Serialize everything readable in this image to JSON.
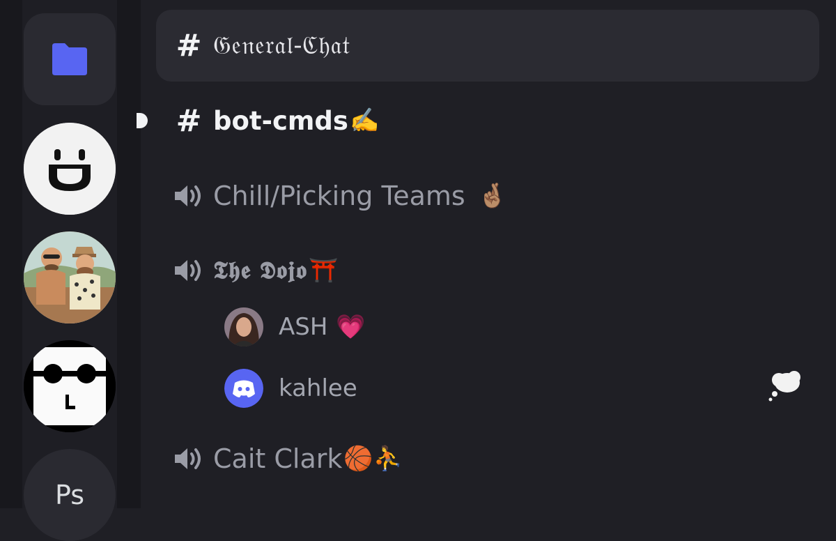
{
  "server_rail": {
    "servers": [
      {
        "name": "folder",
        "icon": "folder-icon",
        "color": "#5865f2"
      },
      {
        "name": "smile-server",
        "icon": "smile-face-icon"
      },
      {
        "name": "photo-server",
        "icon": "illustrated-avatar"
      },
      {
        "name": "shades-server",
        "icon": "sunglasses-face-icon"
      },
      {
        "name": "ps-server",
        "label": "Ps"
      }
    ]
  },
  "channels": [
    {
      "type": "text",
      "name": "𝔊𝔢𝔫𝔢𝔯𝔞𝔩-ℭ𝔥𝔞𝔱",
      "selected": true
    },
    {
      "type": "text",
      "name": "bot-cmds",
      "emoji": "✍️",
      "unread": true
    },
    {
      "type": "voice",
      "name": "Chill/Picking Teams",
      "emoji": "🤞🏽"
    },
    {
      "type": "voice",
      "name": "𝕿𝖍𝖊 𝕯𝖔𝖏𝖔",
      "emoji": "⛩️"
    },
    {
      "type": "voice",
      "name": "Cait Clark",
      "emoji": "🏀⛹️"
    }
  ],
  "voice_members": [
    {
      "name": "ASH",
      "emoji": "💗",
      "avatar": "photo-avatar"
    },
    {
      "name": "kahlee",
      "avatar": "discord-default-avatar",
      "status_icon": "thought-bubble-icon"
    }
  ],
  "colors": {
    "accent": "#5865f2",
    "bg": "#1f1f25",
    "rail": "#18181d"
  }
}
